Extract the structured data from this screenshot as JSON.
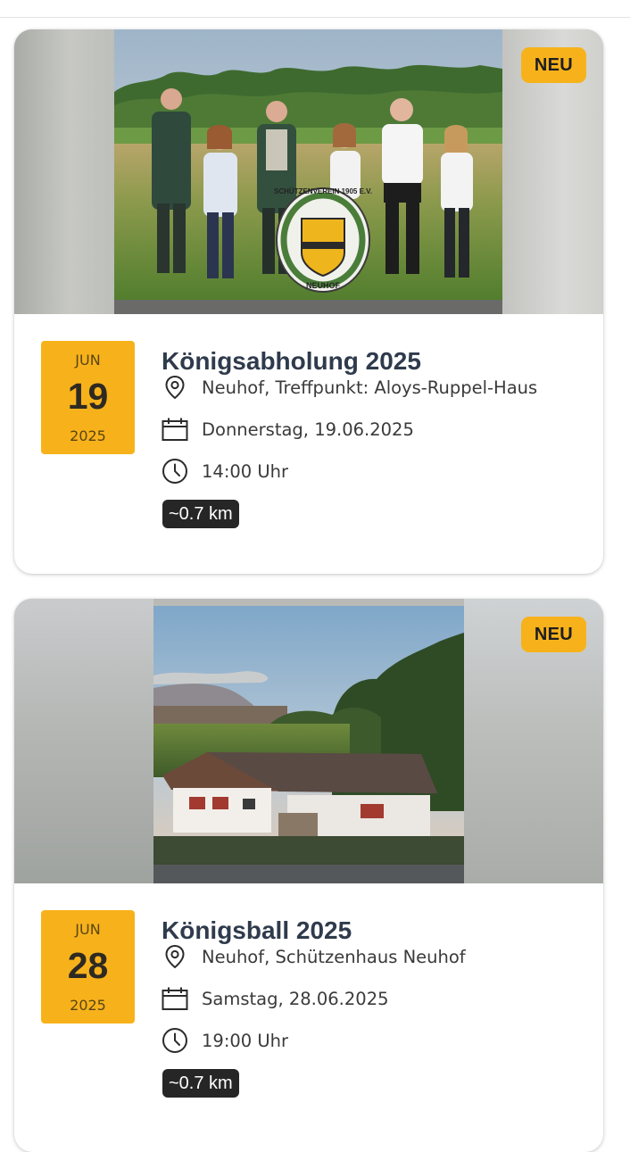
{
  "events": [
    {
      "badge": "NEU",
      "date": {
        "month": "JUN",
        "day": "19",
        "year": "2025"
      },
      "title": "Königsabholung 2025",
      "location": "Neuhof, Treffpunkt: Aloys-Ruppel-Haus",
      "weekday_date": "Donnerstag, 19.06.2025",
      "time": "14:00 Uhr",
      "distance": "~0.7 km",
      "image": {
        "description": "group-photo",
        "emblem_top_text": "SCHÜTZENVEREIN 1905 E.V.",
        "emblem_bottom_text": "NEUHOF"
      }
    },
    {
      "badge": "NEU",
      "date": {
        "month": "JUN",
        "day": "28",
        "year": "2025"
      },
      "title": "Königsball 2025",
      "location": "Neuhof, Schützenhaus Neuhof",
      "weekday_date": "Samstag, 28.06.2025",
      "time": "19:00 Uhr",
      "distance": "~0.7 km",
      "image": {
        "description": "aerial-photo-schuetzenhaus"
      }
    }
  ],
  "icons": {
    "location": "map-pin-icon",
    "date": "calendar-icon",
    "time": "clock-icon"
  },
  "colors": {
    "accent": "#f7b21b",
    "title": "#2f3b4c",
    "distance_bg": "#262626"
  }
}
